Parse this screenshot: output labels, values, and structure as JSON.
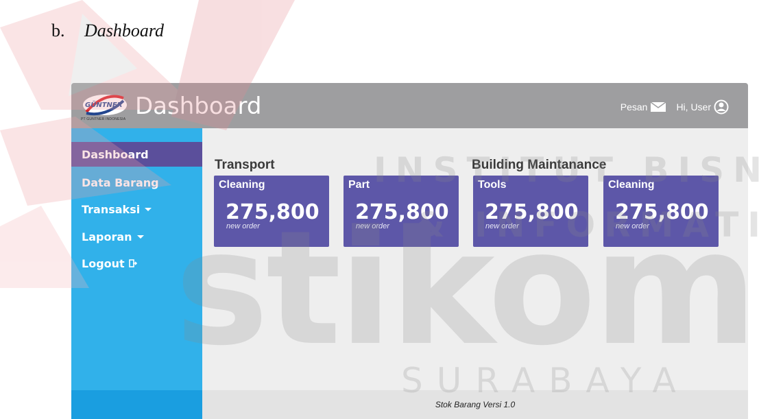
{
  "heading": {
    "letter": "b.",
    "title": "Dashboard"
  },
  "topbar": {
    "logo_text": "GÜNTNER",
    "logo_caption": "PT GUNTNER INDONESIA",
    "title": "Dashboard",
    "message_label": "Pesan",
    "user_label": "Hi, User"
  },
  "sidebar": {
    "items": [
      {
        "label": "Dashboard",
        "active": true
      },
      {
        "label": "Data Barang"
      },
      {
        "label": "Transaksi"
      },
      {
        "label": "Laporan"
      },
      {
        "label": "Logout"
      }
    ]
  },
  "main": {
    "sections": [
      {
        "title": "Transport"
      },
      {
        "title": "Building Maintanance"
      }
    ],
    "cards": [
      {
        "label": "Cleaning",
        "value": "275,800",
        "sub": "new order"
      },
      {
        "label": "Part",
        "value": "275,800",
        "sub": "new order"
      },
      {
        "label": "Tools",
        "value": "275,800",
        "sub": "new order"
      },
      {
        "label": "Cleaning",
        "value": "275,800",
        "sub": "new order"
      }
    ]
  },
  "footer": {
    "text": "Stok Barang Versi 1.0"
  },
  "watermark": {
    "line1": "INSTITUT BISNIS",
    "line2": "& INFORMATIKA",
    "word": "stikom",
    "city": "SURABAYA"
  },
  "colors": {
    "topbar": "#9e9ea0",
    "sidebar": "#31b1ea",
    "active": "#5b4f9b",
    "card": "#5d57a8"
  }
}
